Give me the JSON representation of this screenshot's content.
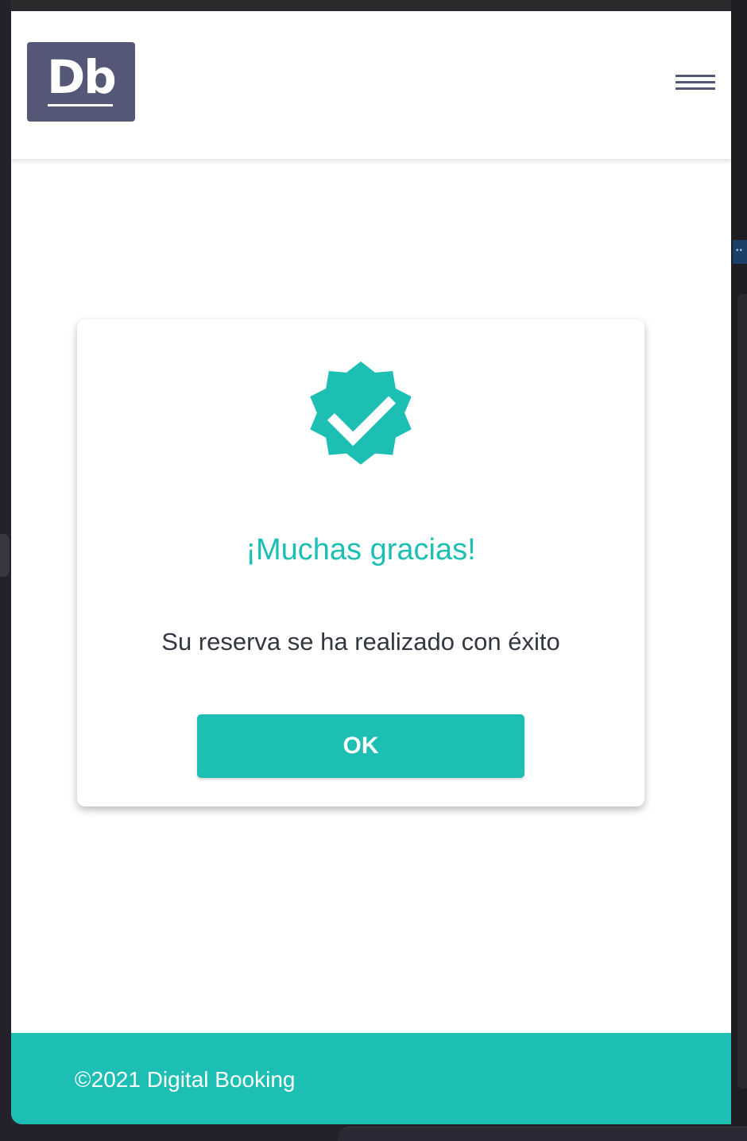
{
  "colors": {
    "brand": "#545776",
    "accent": "#1dbeb4",
    "text": "#31363f",
    "background": "#ffffff"
  },
  "header": {
    "logo_text": "Db",
    "menu_icon": "hamburger-menu-icon"
  },
  "modal": {
    "icon": "verified-check-badge-icon",
    "title": "¡Muchas gracias!",
    "message": "Su reserva se ha realizado con éxito",
    "ok_label": "OK"
  },
  "footer": {
    "copyright": "©2021 Digital Booking"
  }
}
